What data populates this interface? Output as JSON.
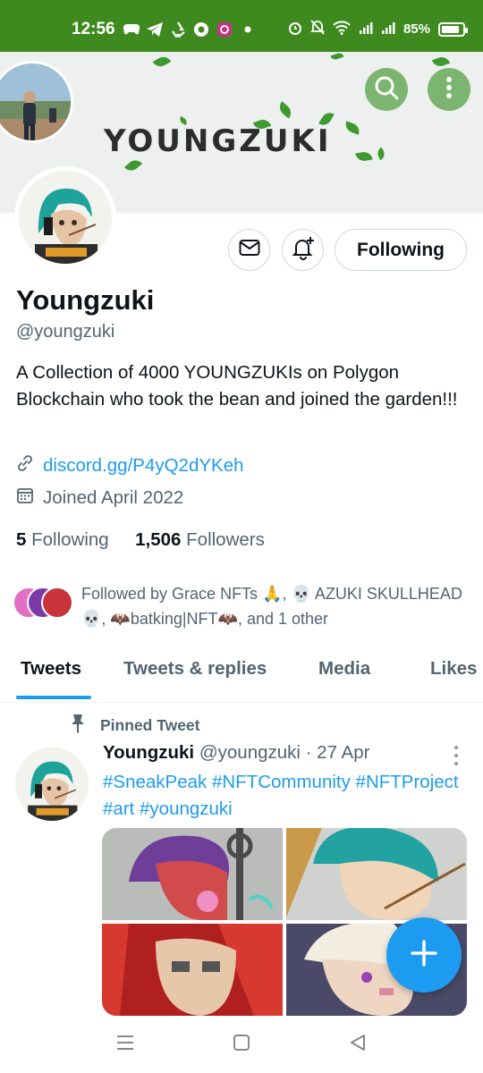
{
  "status_bar": {
    "time": "12:56",
    "battery_text": "85%",
    "battery_level": 0.85,
    "left_icons": [
      "game-controller-icon",
      "telegram-icon",
      "recycle-icon",
      "chrome-icon",
      "instagram-icon",
      "dot-icon"
    ],
    "right_icons": [
      "alarm-icon",
      "mute-bell-icon",
      "wifi-icon",
      "signal-icon",
      "signal-icon",
      "battery-icon"
    ]
  },
  "banner": {
    "title": "YOUNGZUKI",
    "background_color": "#eef0f0",
    "accent_color": "#3c9a2e"
  },
  "profile": {
    "name": "Youngzuki",
    "handle": "@youngzuki",
    "bio": "A Collection of 4000 YOUNGZUKIs on Polygon Blockchain who took the bean and joined the garden!!!",
    "link": "discord.gg/P4yQ2dYKeh",
    "joined": "Joined April 2022",
    "following_count": "5",
    "following_label": "Following",
    "followers_count": "1,506",
    "followers_label": "Followers",
    "followed_by_text": "Followed by Grace NFTs 🙏, 💀 AZUKI SKULLHEAD 💀, 🦇batking|NFT🦇, and 1 other"
  },
  "actions": {
    "following_button": "Following"
  },
  "tabs": [
    {
      "label": "Tweets",
      "active": true
    },
    {
      "label": "Tweets & replies",
      "active": false
    },
    {
      "label": "Media",
      "active": false
    },
    {
      "label": "Likes",
      "active": false
    }
  ],
  "pinned_tweet": {
    "pinned_label": "Pinned Tweet",
    "author_name": "Youngzuki",
    "author_handle": "@youngzuki",
    "date": "· 27 Apr",
    "text": "#SneakPeak #NFTCommunity #NFTProject #art #youngzuki"
  },
  "colors": {
    "status_bar": "#3e8a1f",
    "link_blue": "#1d9bf0",
    "secondary_text": "#536471"
  }
}
